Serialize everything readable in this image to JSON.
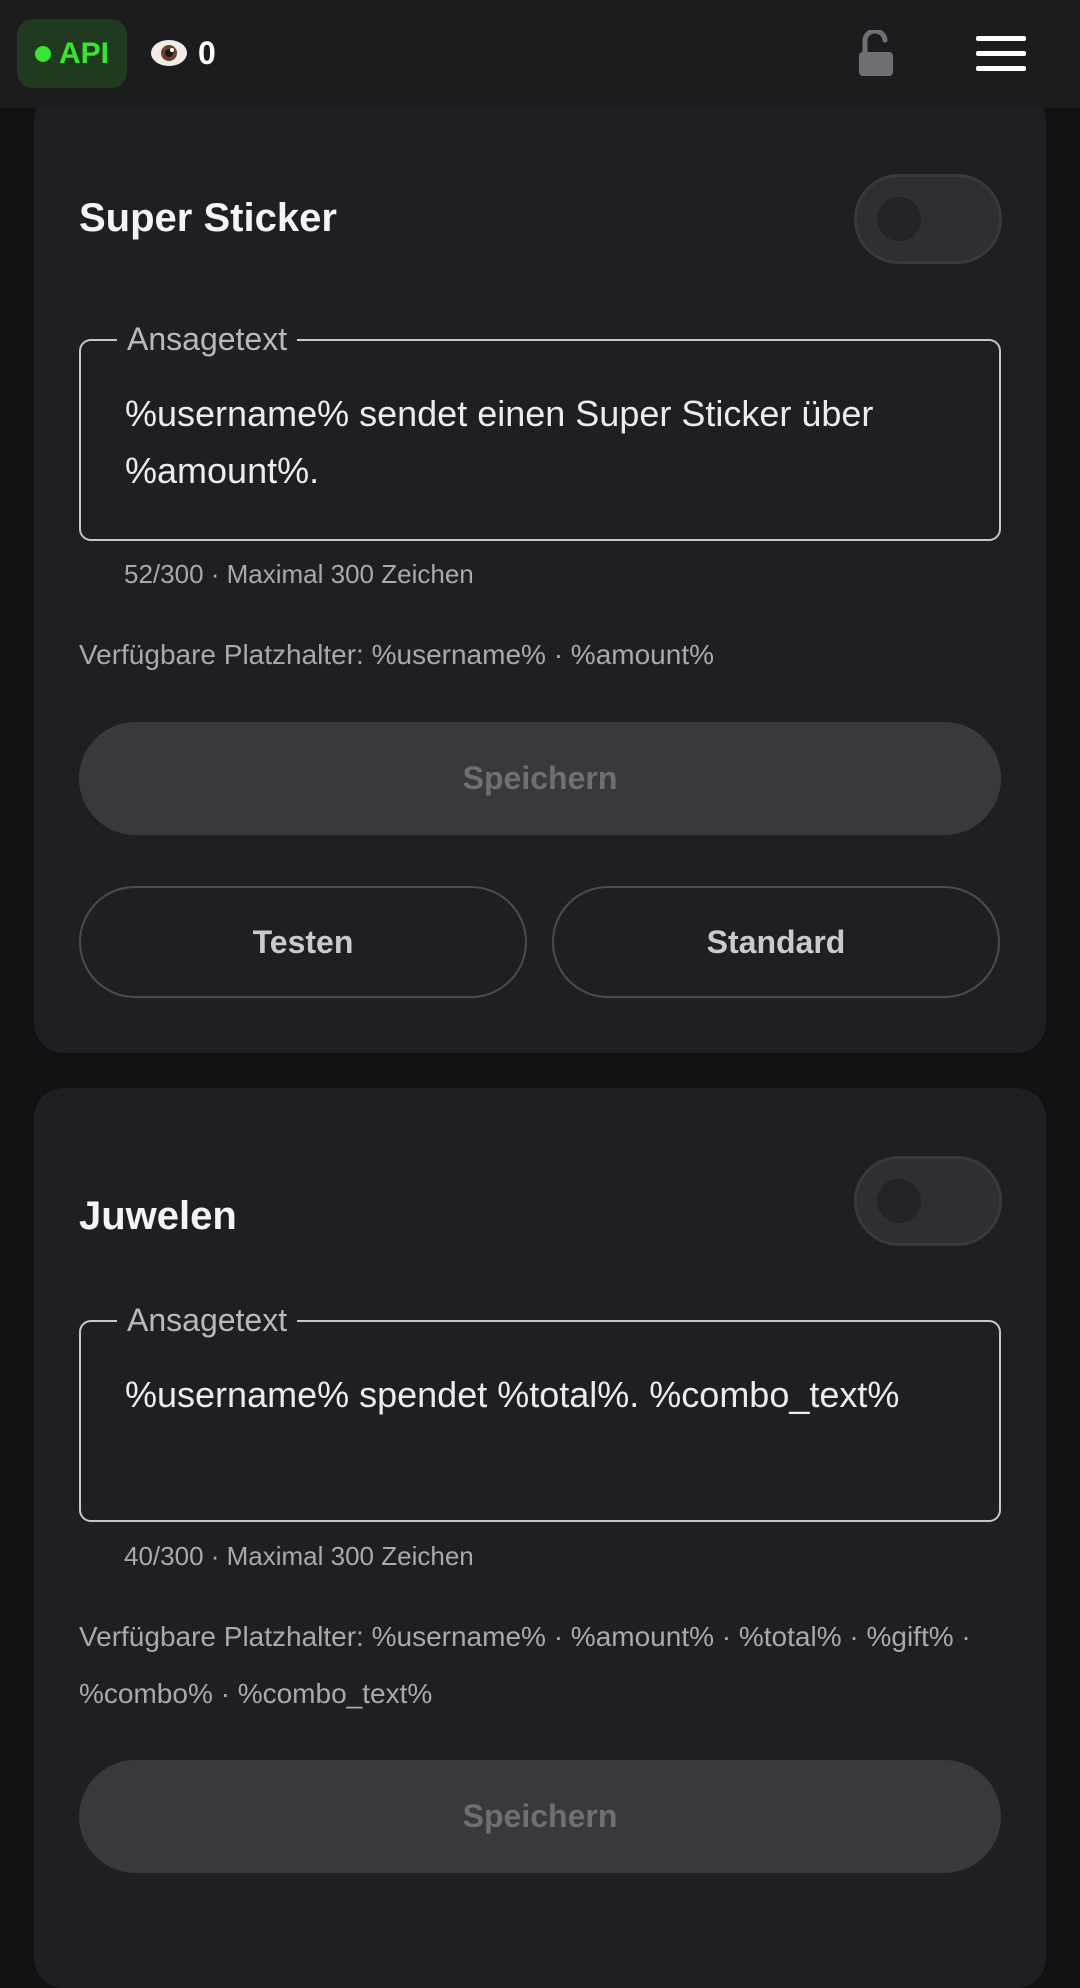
{
  "topbar": {
    "api_label": "API",
    "api_status_color": "#39e52f",
    "viewer_count": "0",
    "icons": [
      "eye-icon",
      "unlock-icon",
      "hamburger-menu-icon"
    ]
  },
  "cards": [
    {
      "title": "Super Sticker",
      "toggle_on": false,
      "field_label": "Ansagetext",
      "field_value": "%username% sendet einen Super Sticker über %amount%.",
      "helper": "52/300 · Maximal 300 Zeichen",
      "placeholders": "Verfügbare Platzhalter: %username% · %amount%",
      "save_label": "Speichern",
      "test_label": "Testen",
      "default_label": "Standard"
    },
    {
      "title": "Juwelen",
      "toggle_on": false,
      "field_label": "Ansagetext",
      "field_value": "%username% spendet %total%. %combo_text%",
      "helper": "40/300 · Maximal 300 Zeichen",
      "placeholders": "Verfügbare Platzhalter: %username% · %amount% · %total% · %gift% · %combo% · %combo_text%",
      "save_label": "Speichern"
    }
  ]
}
